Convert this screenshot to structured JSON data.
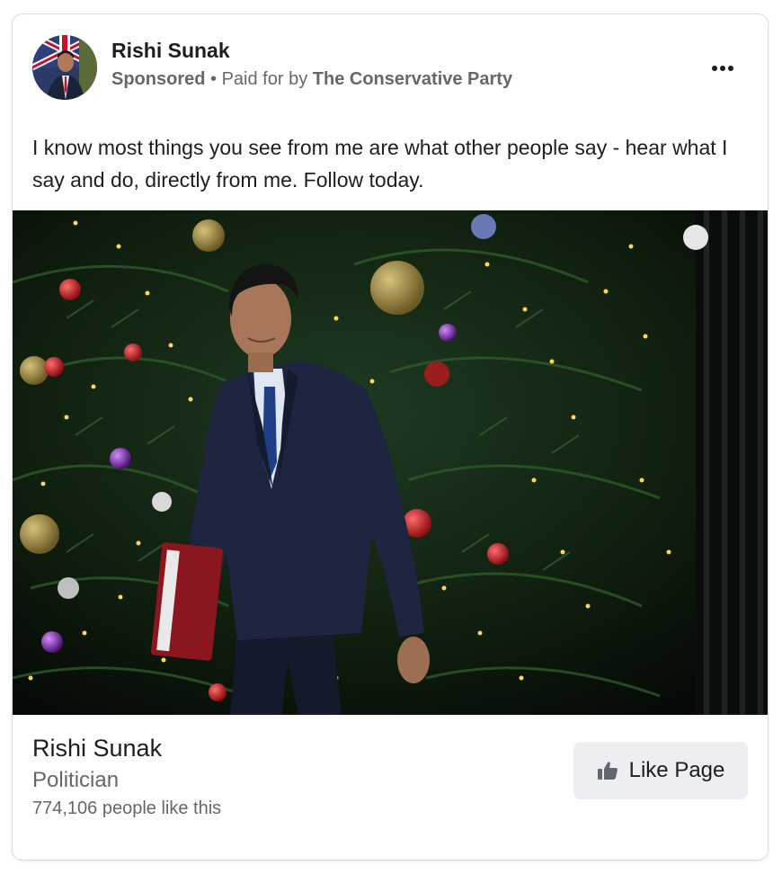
{
  "post": {
    "author": "Rishi Sunak",
    "sponsored": "Sponsored",
    "separator": "•",
    "paid_for_prefix": "Paid for by",
    "payer": "The Conservative Party",
    "caption": "I know most things you see from me are what other people say - hear what I say and do, directly from me. Follow today.",
    "more_icon": "more-horizontal-icon"
  },
  "page_card": {
    "name": "Rishi Sunak",
    "category": "Politician",
    "likes": "774,106 people like this",
    "like_button_label": "Like Page",
    "like_icon": "thumbs-up-icon"
  },
  "colors": {
    "secondary_text": "#65676b",
    "button_bg": "#eceef1",
    "border": "#dadde1"
  }
}
